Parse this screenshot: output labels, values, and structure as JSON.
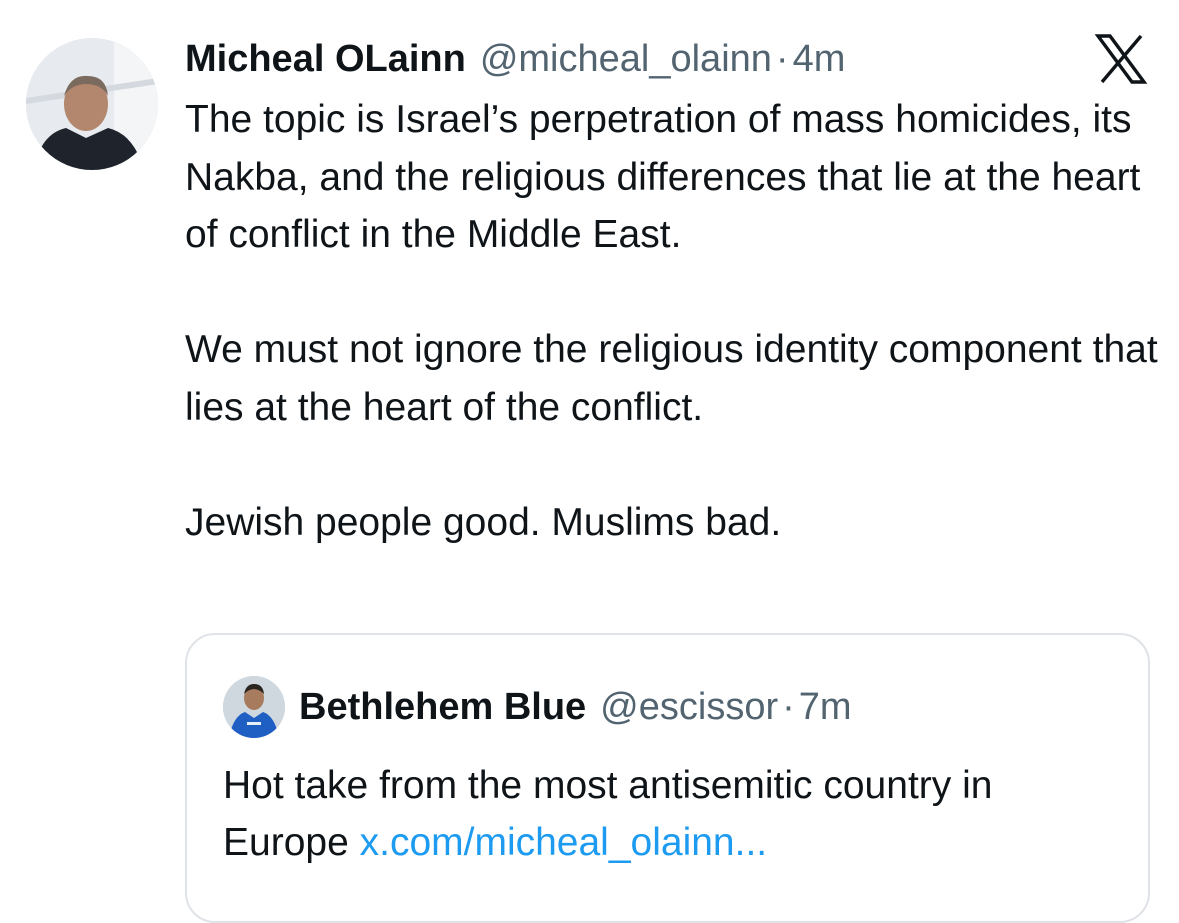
{
  "tweet": {
    "author_name": "Micheal OLainn",
    "author_handle": "@micheal_olainn",
    "separator": "·",
    "time": "4m",
    "paragraphs": [
      "The topic is Israel’s perpetration of mass homicides, its Nakba, and the religious differences that lie at the heart of conflict in the Middle East.",
      "We must not ignore the religious identity component that lies at the heart of the conflict.",
      "Jewish people good. Muslims bad."
    ]
  },
  "quoted_tweet": {
    "author_name": "Bethlehem Blue",
    "author_handle": "@escissor",
    "separator": "·",
    "time": "7m",
    "text": "Hot take from the most antisemitic country in Europe",
    "link": "x.com/micheal_olainn..."
  },
  "icons": {
    "brand": "x-logo-icon",
    "author_avatar": "avatar",
    "quoted_avatar": "avatar"
  },
  "colors": {
    "text_primary": "#0f1419",
    "text_secondary": "#536471",
    "link": "#1d9bf0",
    "card_border": "#dfe3e7"
  }
}
